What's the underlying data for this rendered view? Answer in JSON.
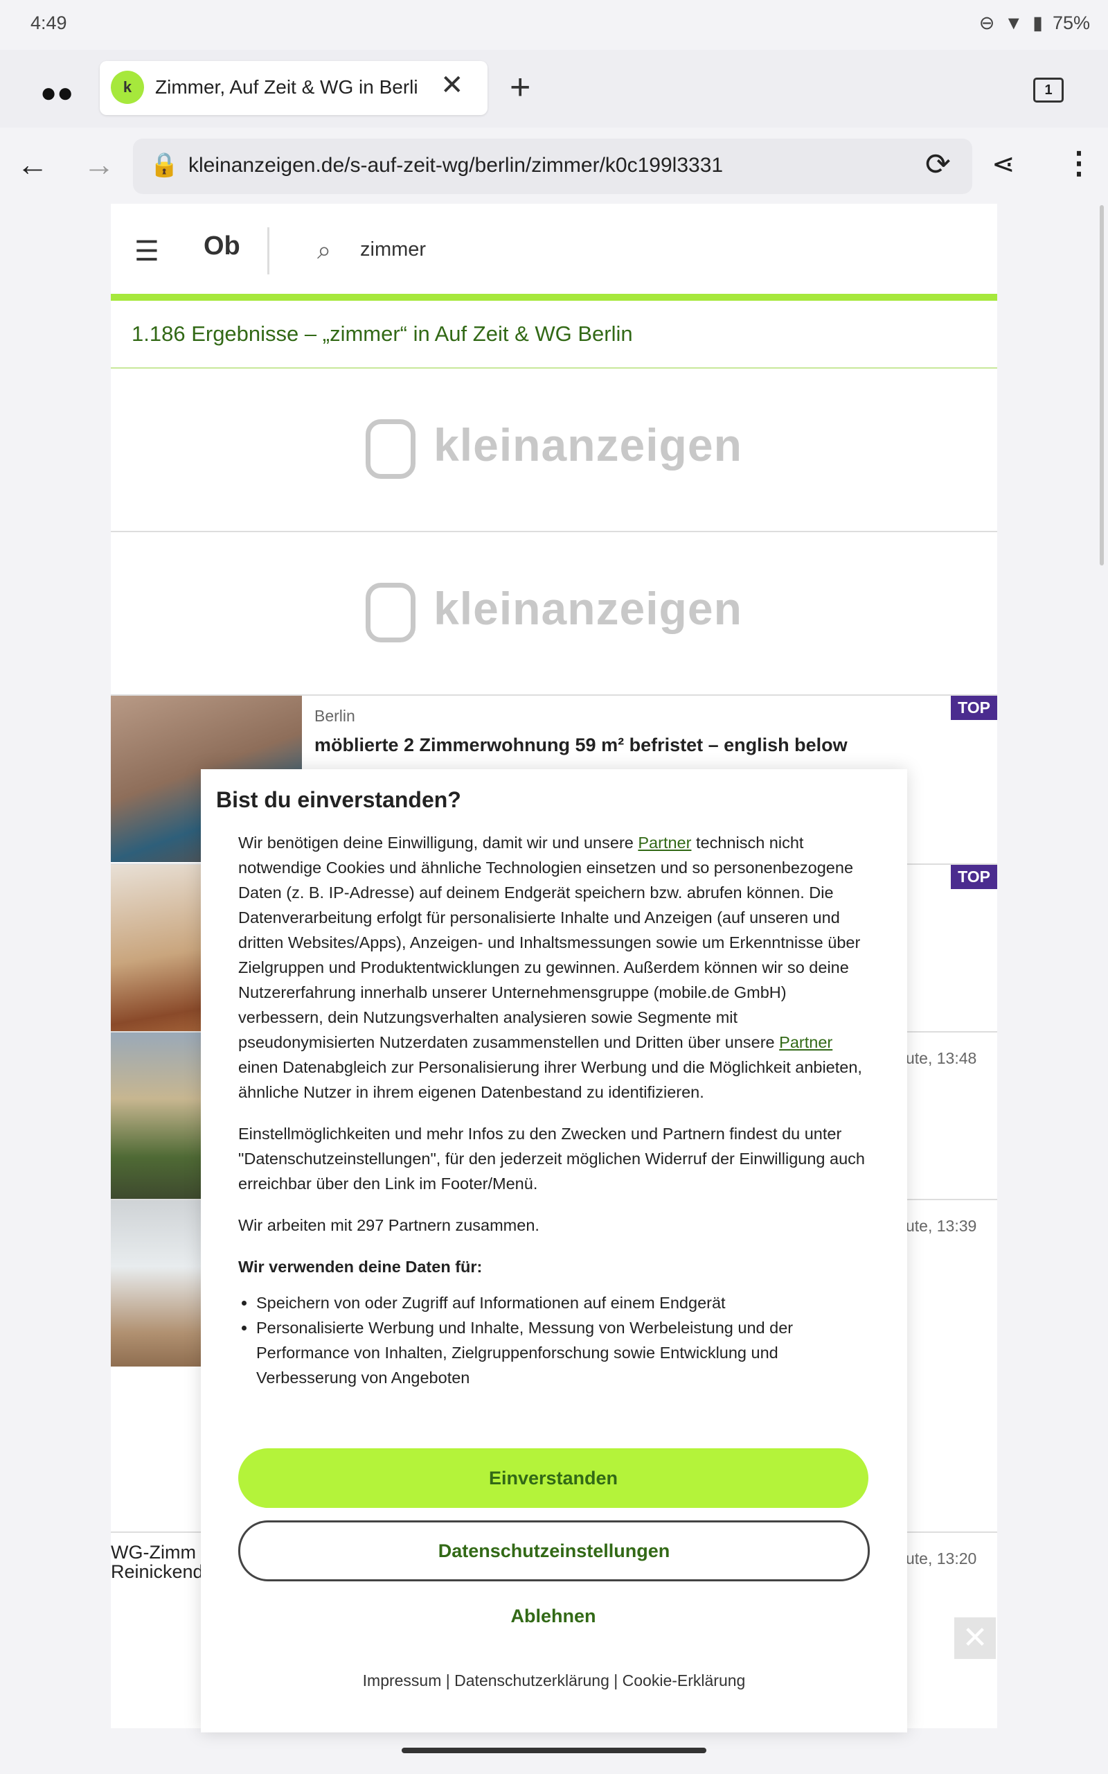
{
  "status": {
    "time": "4:49",
    "battery": "75%"
  },
  "browser": {
    "tab_title": "Zimmer, Auf Zeit & WG in Berli",
    "tab_count": "1",
    "url": "kleinanzeigen.de/s-auf-zeit-wg/berlin/zimmer/k0c199l3331"
  },
  "site": {
    "search_value": "zimmer",
    "results": "1.186 Ergebnisse – „zimmer“ in Auf Zeit & WG Berlin",
    "banner_word": "kleinanzeigen"
  },
  "listings": [
    {
      "location": "Berlin",
      "title": "möblierte 2 Zimmerwohnung 59 m² befristet – english below",
      "badge": "TOP"
    },
    {
      "badge": "TOP"
    },
    {
      "time": "ute, 13:48"
    },
    {
      "time": "ute, 13:39"
    },
    {
      "title": "WG-Zimm",
      "title2": "Reinickend",
      "time": "ute, 13:20"
    }
  ],
  "modal": {
    "title": "Bist du einverstanden?",
    "p1_a": "Wir benötigen deine Einwilligung, damit wir und unsere ",
    "partner_link": "Partner",
    "p1_b": " technisch nicht notwendige Cookies und ähnliche Technologien einsetzen und so personenbezogene Daten (z. B. IP-Adresse) auf deinem Endgerät speichern bzw. abrufen können. Die Datenverarbeitung erfolgt für personalisierte Inhalte und Anzeigen (auf unseren und dritten Websites/Apps), Anzeigen- und Inhaltsmessungen sowie um Erkenntnisse über Zielgruppen und Produktentwicklungen zu gewinnen. Außerdem können wir so deine Nutzererfahrung innerhalb unserer Unternehmensgruppe (mobile.de GmbH) verbessern, dein Nutzungsverhalten analysieren sowie Segmente mit pseudonymisierten Nutzerdaten zusammenstellen und Dritten über unsere ",
    "p1_c": " einen Datenabgleich zur Personalisierung ihrer Werbung und die Möglichkeit anbieten, ähnliche Nutzer in ihrem eigenen Datenbestand zu identifizieren.",
    "p2": "Einstellmöglichkeiten und mehr Infos zu den Zwecken und Partnern findest du unter \"Datenschutzeinstellungen\", für den jederzeit möglichen Widerruf der Einwilligung auch erreichbar über den Link im Footer/Menü.",
    "p3": "Wir arbeiten mit 297 Partnern zusammen.",
    "p4": "Wir verwenden deine Daten für:",
    "purposes": [
      "Speichern von oder Zugriff auf Informationen auf einem Endgerät",
      "Personalisierte Werbung und Inhalte, Messung von Werbeleistung und der Performance von Inhalten, Zielgruppenforschung sowie Entwicklung und Verbesserung von Angeboten"
    ],
    "accept": "Einverstanden",
    "settings": "Datenschutzeinstellungen",
    "decline": "Ablehnen",
    "footer_impressum": "Impressum",
    "footer_datenschutz": "Datenschutzerklärung",
    "footer_cookie": "Cookie-Erklärung"
  }
}
